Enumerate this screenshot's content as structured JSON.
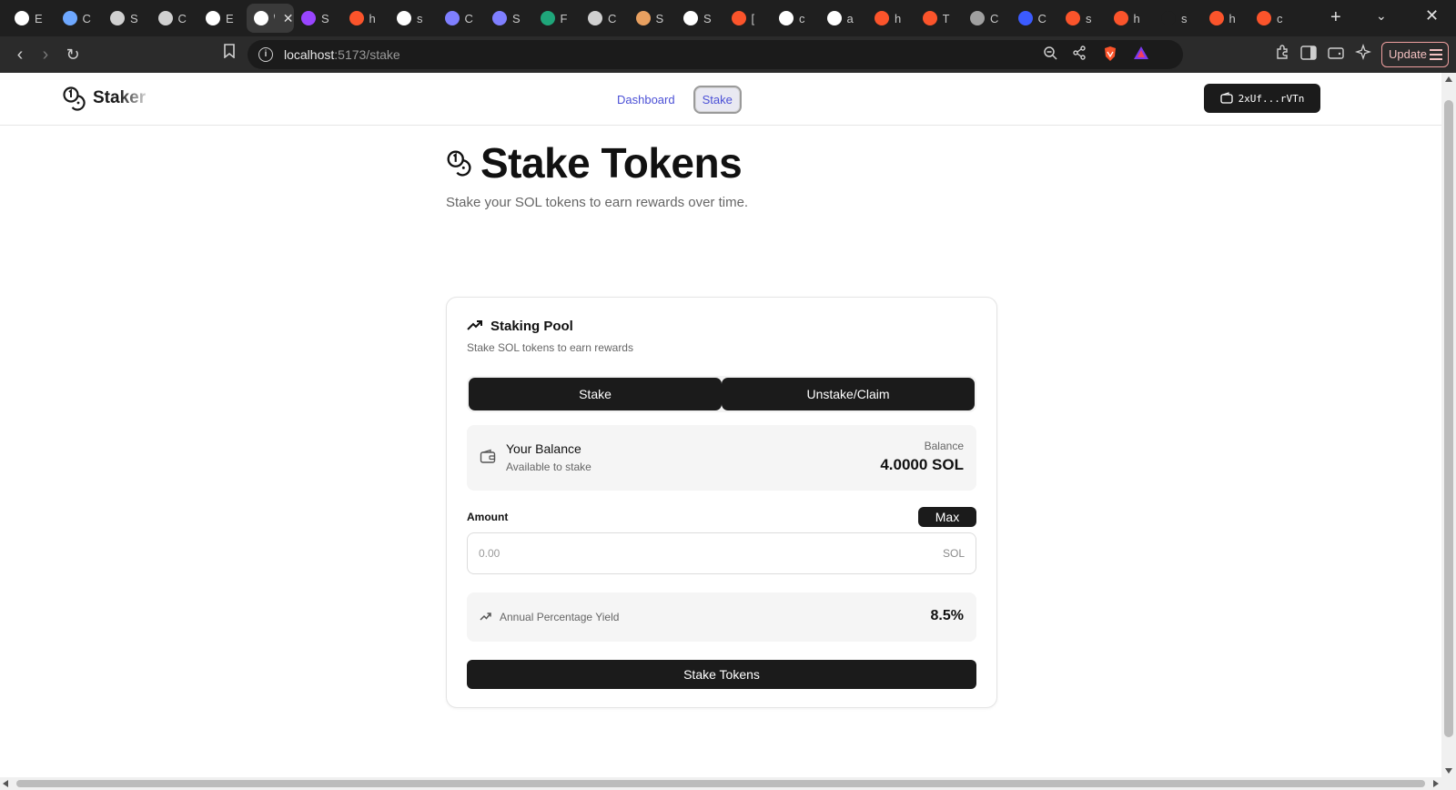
{
  "browser": {
    "tabs": [
      {
        "icon": "github-icon",
        "label": "E",
        "color": "#ffffff"
      },
      {
        "icon": "gemini-icon",
        "label": "C",
        "color": "#6ea8ff"
      },
      {
        "icon": "openai-icon",
        "label": "S",
        "color": "#d0d0d0"
      },
      {
        "icon": "globe-icon",
        "label": "C",
        "color": "#d0d0d0"
      },
      {
        "icon": "github-icon",
        "label": "E",
        "color": "#ffffff"
      },
      {
        "icon": "vercel-icon",
        "label": "\\",
        "color": "#ffffff",
        "active": true
      },
      {
        "icon": "solana-icon",
        "label": "S",
        "color": "#9945ff"
      },
      {
        "icon": "brave-icon",
        "label": "h",
        "color": "#fb542b"
      },
      {
        "icon": "github-icon",
        "label": "s",
        "color": "#ffffff"
      },
      {
        "icon": "app-icon",
        "label": "C",
        "color": "#7f7fff"
      },
      {
        "icon": "app-icon",
        "label": "S",
        "color": "#7f7fff"
      },
      {
        "icon": "app-icon",
        "label": "F",
        "color": "#1fa67a"
      },
      {
        "icon": "app-icon",
        "label": "C",
        "color": "#d0d0d0"
      },
      {
        "icon": "app-icon",
        "label": "S",
        "color": "#e8a060"
      },
      {
        "icon": "app-icon",
        "label": "S",
        "color": "#ffffff"
      },
      {
        "icon": "brave-icon",
        "label": "[",
        "color": "#fb542b"
      },
      {
        "icon": "notion-icon",
        "label": "c",
        "color": "#ffffff"
      },
      {
        "icon": "github-icon",
        "label": "a",
        "color": "#ffffff"
      },
      {
        "icon": "brave-icon",
        "label": "h",
        "color": "#fb542b"
      },
      {
        "icon": "brave-icon",
        "label": "T",
        "color": "#fb542b"
      },
      {
        "icon": "app-icon",
        "label": "C",
        "color": "#a0a0a0"
      },
      {
        "icon": "app-icon",
        "label": "C",
        "color": "#3b5bff"
      },
      {
        "icon": "brave-icon",
        "label": "s",
        "color": "#fb542b"
      },
      {
        "icon": "brave-icon",
        "label": "h",
        "color": "#fb542b"
      },
      {
        "icon": "blank-icon",
        "label": "s",
        "color": "#1f1f1f"
      },
      {
        "icon": "brave-icon",
        "label": "h",
        "color": "#fb542b"
      },
      {
        "icon": "brave-icon",
        "label": "c",
        "color": "#fb542b"
      }
    ],
    "url_host": "localhost",
    "url_path": ":5173/stake",
    "update_label": "Update"
  },
  "header": {
    "logo_text": "Staker",
    "nav": [
      {
        "label": "Dashboard"
      },
      {
        "label": "Stake"
      }
    ],
    "wallet_label": "2xUf...rVTn"
  },
  "page": {
    "title": "Stake Tokens",
    "subtitle": "Stake your SOL tokens to earn rewards over time."
  },
  "card": {
    "title": "Staking Pool",
    "subtitle": "Stake SOL tokens to earn rewards",
    "tabs": [
      "Stake",
      "Unstake/Claim"
    ],
    "balance": {
      "label": "Your Balance",
      "sub": "Available to stake",
      "right_label": "Balance",
      "value": "4.0000 SOL"
    },
    "amount": {
      "label": "Amount",
      "max_label": "Max",
      "placeholder": "0.00",
      "value": "",
      "unit": "SOL"
    },
    "apy": {
      "label": "Annual Percentage Yield",
      "value": "8.5%"
    },
    "submit_label": "Stake Tokens"
  },
  "colors": {
    "accent_dark": "#1b1b1b",
    "nav_link": "#4b50d6",
    "brave_orange": "#fb542b"
  }
}
